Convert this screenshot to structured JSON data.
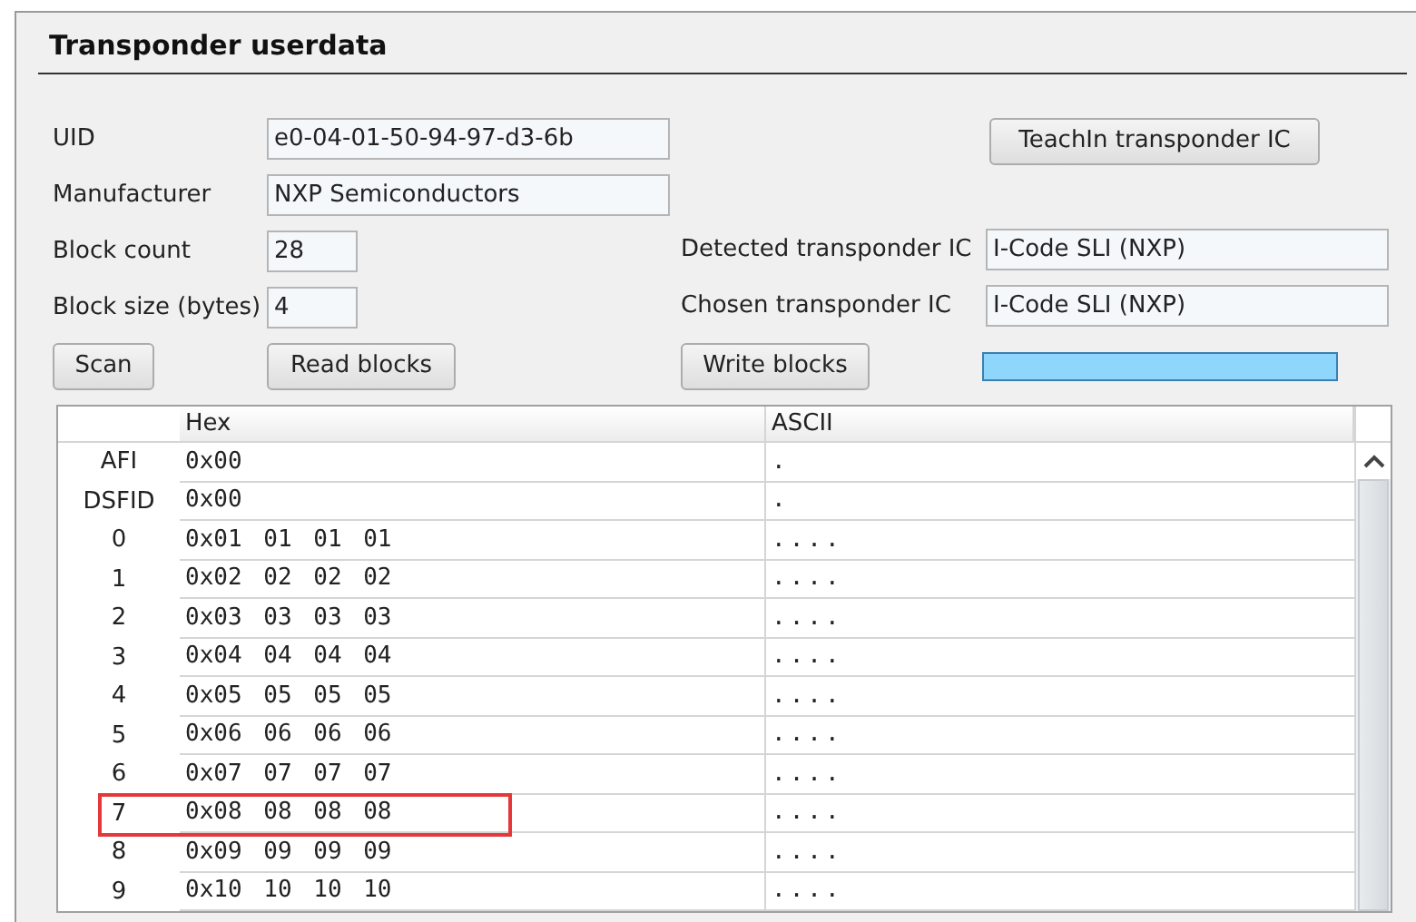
{
  "title": "Transponder userdata",
  "fields": [
    {
      "label": "UID",
      "value": "e0-04-01-50-94-97-d3-6b",
      "kind": "wide"
    },
    {
      "label": "Manufacturer",
      "value": "NXP Semiconductors",
      "kind": "wide"
    },
    {
      "label": "Block count",
      "value": "28",
      "kind": "narrow"
    },
    {
      "label": "Block size (bytes)",
      "value": "4",
      "kind": "narrow"
    }
  ],
  "teachin_button": "TeachIn transponder IC",
  "ic_fields": [
    {
      "label": "Detected transponder IC",
      "value": "I-Code SLI (NXP)"
    },
    {
      "label": "Chosen transponder IC",
      "value": "I-Code SLI (NXP)"
    }
  ],
  "buttons": [
    "Scan",
    "Read blocks",
    "Write blocks"
  ],
  "progress": {
    "level": 1
  },
  "table": {
    "columns": [
      "Hex",
      "ASCII"
    ],
    "rows": [
      {
        "header": "AFI",
        "hex": "0x00",
        "ascii": ".",
        "highlighted": false
      },
      {
        "header": "DSFID",
        "hex": "0x00",
        "ascii": ".",
        "highlighted": false
      },
      {
        "header": "0",
        "hex": "0x01 01 01 01",
        "ascii": "....",
        "highlighted": false
      },
      {
        "header": "1",
        "hex": "0x02 02 02 02",
        "ascii": "....",
        "highlighted": false
      },
      {
        "header": "2",
        "hex": "0x03 03 03 03",
        "ascii": "....",
        "highlighted": false
      },
      {
        "header": "3",
        "hex": "0x04 04 04 04",
        "ascii": "....",
        "highlighted": false
      },
      {
        "header": "4",
        "hex": "0x05 05 05 05",
        "ascii": "....",
        "highlighted": false
      },
      {
        "header": "5",
        "hex": "0x06 06 06 06",
        "ascii": "....",
        "highlighted": false
      },
      {
        "header": "6",
        "hex": "0x07 07 07 07",
        "ascii": "....",
        "highlighted": false
      },
      {
        "header": "7",
        "hex": "0x08 08 08 08",
        "ascii": "....",
        "highlighted": true
      },
      {
        "header": "8",
        "hex": "0x09 09 09 09",
        "ascii": "....",
        "highlighted": false
      },
      {
        "header": "9",
        "hex": "0x10 10 10 10",
        "ascii": "....",
        "highlighted": false
      }
    ]
  }
}
